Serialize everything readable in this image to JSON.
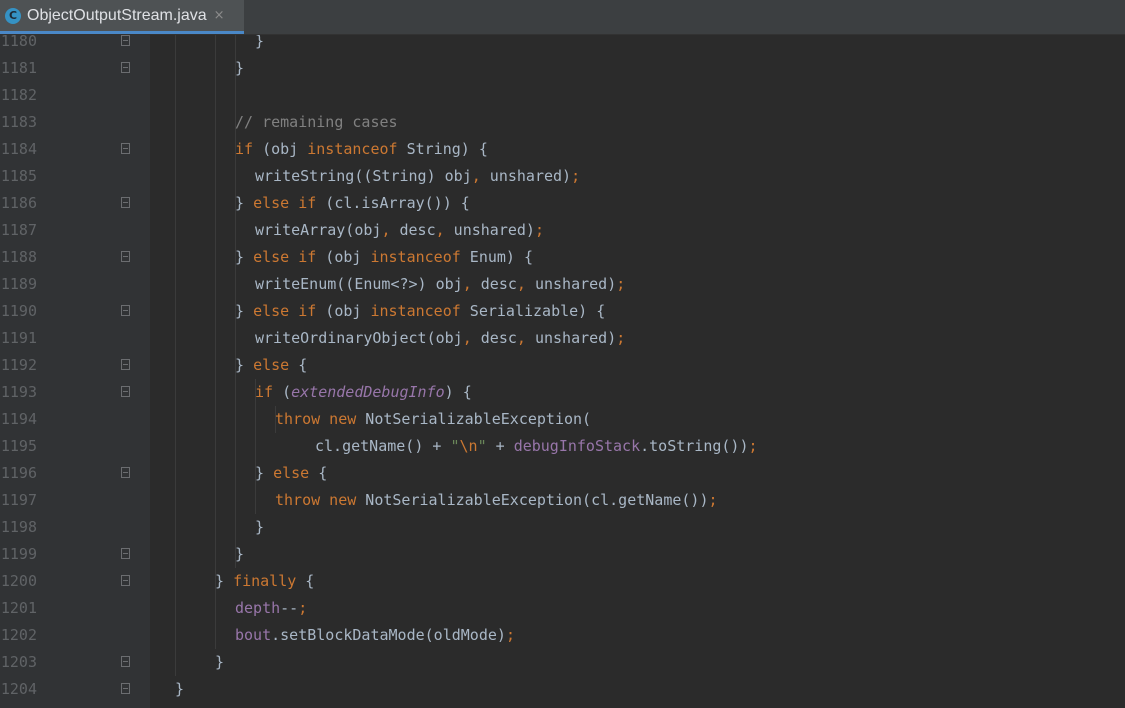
{
  "tab": {
    "icon_letter": "C",
    "title": "ObjectOutputStream.java",
    "close_glyph": "×"
  },
  "editor": {
    "lines": [
      {
        "num": "1180",
        "indent": 8,
        "tokens": [
          {
            "t": "}",
            "c": ""
          }
        ]
      },
      {
        "num": "1181",
        "indent": 6,
        "tokens": [
          {
            "t": "}",
            "c": ""
          }
        ]
      },
      {
        "num": "1182",
        "indent": 0,
        "tokens": []
      },
      {
        "num": "1183",
        "indent": 6,
        "tokens": [
          {
            "t": "// remaining cases",
            "c": "cm"
          }
        ]
      },
      {
        "num": "1184",
        "indent": 6,
        "tokens": [
          {
            "t": "if",
            "c": "kw"
          },
          {
            "t": " (obj ",
            "c": ""
          },
          {
            "t": "instanceof",
            "c": "kw"
          },
          {
            "t": " String) {",
            "c": ""
          }
        ]
      },
      {
        "num": "1185",
        "indent": 8,
        "tokens": [
          {
            "t": "writeString((String) obj",
            "c": ""
          },
          {
            "t": ",",
            "c": "kw"
          },
          {
            "t": " unshared)",
            "c": ""
          },
          {
            "t": ";",
            "c": "kw"
          }
        ]
      },
      {
        "num": "1186",
        "indent": 6,
        "tokens": [
          {
            "t": "} ",
            "c": ""
          },
          {
            "t": "else if",
            "c": "kw"
          },
          {
            "t": " (cl.isArray()) {",
            "c": ""
          }
        ]
      },
      {
        "num": "1187",
        "indent": 8,
        "tokens": [
          {
            "t": "writeArray(obj",
            "c": ""
          },
          {
            "t": ",",
            "c": "kw"
          },
          {
            "t": " desc",
            "c": ""
          },
          {
            "t": ",",
            "c": "kw"
          },
          {
            "t": " unshared)",
            "c": ""
          },
          {
            "t": ";",
            "c": "kw"
          }
        ]
      },
      {
        "num": "1188",
        "indent": 6,
        "tokens": [
          {
            "t": "} ",
            "c": ""
          },
          {
            "t": "else if",
            "c": "kw"
          },
          {
            "t": " (obj ",
            "c": ""
          },
          {
            "t": "instanceof",
            "c": "kw"
          },
          {
            "t": " Enum) {",
            "c": ""
          }
        ]
      },
      {
        "num": "1189",
        "indent": 8,
        "tokens": [
          {
            "t": "writeEnum((Enum<?>) obj",
            "c": ""
          },
          {
            "t": ",",
            "c": "kw"
          },
          {
            "t": " desc",
            "c": ""
          },
          {
            "t": ",",
            "c": "kw"
          },
          {
            "t": " unshared)",
            "c": ""
          },
          {
            "t": ";",
            "c": "kw"
          }
        ]
      },
      {
        "num": "1190",
        "indent": 6,
        "tokens": [
          {
            "t": "} ",
            "c": ""
          },
          {
            "t": "else if",
            "c": "kw"
          },
          {
            "t": " (obj ",
            "c": ""
          },
          {
            "t": "instanceof",
            "c": "kw"
          },
          {
            "t": " Serializable) {",
            "c": ""
          }
        ]
      },
      {
        "num": "1191",
        "indent": 8,
        "tokens": [
          {
            "t": "writeOrdinaryObject(obj",
            "c": ""
          },
          {
            "t": ",",
            "c": "kw"
          },
          {
            "t": " desc",
            "c": ""
          },
          {
            "t": ",",
            "c": "kw"
          },
          {
            "t": " unshared)",
            "c": ""
          },
          {
            "t": ";",
            "c": "kw"
          }
        ]
      },
      {
        "num": "1192",
        "indent": 6,
        "tokens": [
          {
            "t": "} ",
            "c": ""
          },
          {
            "t": "else",
            "c": "kw"
          },
          {
            "t": " {",
            "c": ""
          }
        ]
      },
      {
        "num": "1193",
        "indent": 8,
        "tokens": [
          {
            "t": "if",
            "c": "kw"
          },
          {
            "t": " (",
            "c": ""
          },
          {
            "t": "extendedDebugInfo",
            "c": "fld it"
          },
          {
            "t": ") {",
            "c": ""
          }
        ]
      },
      {
        "num": "1194",
        "indent": 10,
        "tokens": [
          {
            "t": "throw new",
            "c": "kw"
          },
          {
            "t": " NotSerializableException(",
            "c": ""
          }
        ]
      },
      {
        "num": "1195",
        "indent": 14,
        "tokens": [
          {
            "t": "cl.getName() + ",
            "c": ""
          },
          {
            "t": "\"",
            "c": "str"
          },
          {
            "t": "\\n",
            "c": "esc"
          },
          {
            "t": "\"",
            "c": "str"
          },
          {
            "t": " + ",
            "c": ""
          },
          {
            "t": "debugInfoStack",
            "c": "fld"
          },
          {
            "t": ".toString())",
            "c": ""
          },
          {
            "t": ";",
            "c": "kw"
          }
        ]
      },
      {
        "num": "1196",
        "indent": 8,
        "tokens": [
          {
            "t": "} ",
            "c": ""
          },
          {
            "t": "else",
            "c": "kw"
          },
          {
            "t": " {",
            "c": ""
          }
        ]
      },
      {
        "num": "1197",
        "indent": 10,
        "tokens": [
          {
            "t": "throw new",
            "c": "kw"
          },
          {
            "t": " NotSerializableException(cl.getName())",
            "c": ""
          },
          {
            "t": ";",
            "c": "kw"
          }
        ]
      },
      {
        "num": "1198",
        "indent": 8,
        "tokens": [
          {
            "t": "}",
            "c": ""
          }
        ]
      },
      {
        "num": "1199",
        "indent": 6,
        "tokens": [
          {
            "t": "}",
            "c": ""
          }
        ]
      },
      {
        "num": "1200",
        "indent": 4,
        "tokens": [
          {
            "t": "} ",
            "c": ""
          },
          {
            "t": "finally",
            "c": "kw"
          },
          {
            "t": " {",
            "c": ""
          }
        ]
      },
      {
        "num": "1201",
        "indent": 6,
        "tokens": [
          {
            "t": "depth",
            "c": "fld"
          },
          {
            "t": "--",
            "c": ""
          },
          {
            "t": ";",
            "c": "kw"
          }
        ]
      },
      {
        "num": "1202",
        "indent": 6,
        "tokens": [
          {
            "t": "bout",
            "c": "fld"
          },
          {
            "t": ".setBlockDataMode(oldMode)",
            "c": ""
          },
          {
            "t": ";",
            "c": "kw"
          }
        ]
      },
      {
        "num": "1203",
        "indent": 4,
        "tokens": [
          {
            "t": "}",
            "c": ""
          }
        ]
      },
      {
        "num": "1204",
        "indent": 0,
        "tokens": [
          {
            "t": "}",
            "c": ""
          }
        ]
      }
    ],
    "fold_lines": [
      "1180",
      "1181",
      "1184",
      "1186",
      "1188",
      "1190",
      "1192",
      "1193",
      "1196",
      "1199",
      "1200",
      "1203",
      "1204"
    ]
  }
}
